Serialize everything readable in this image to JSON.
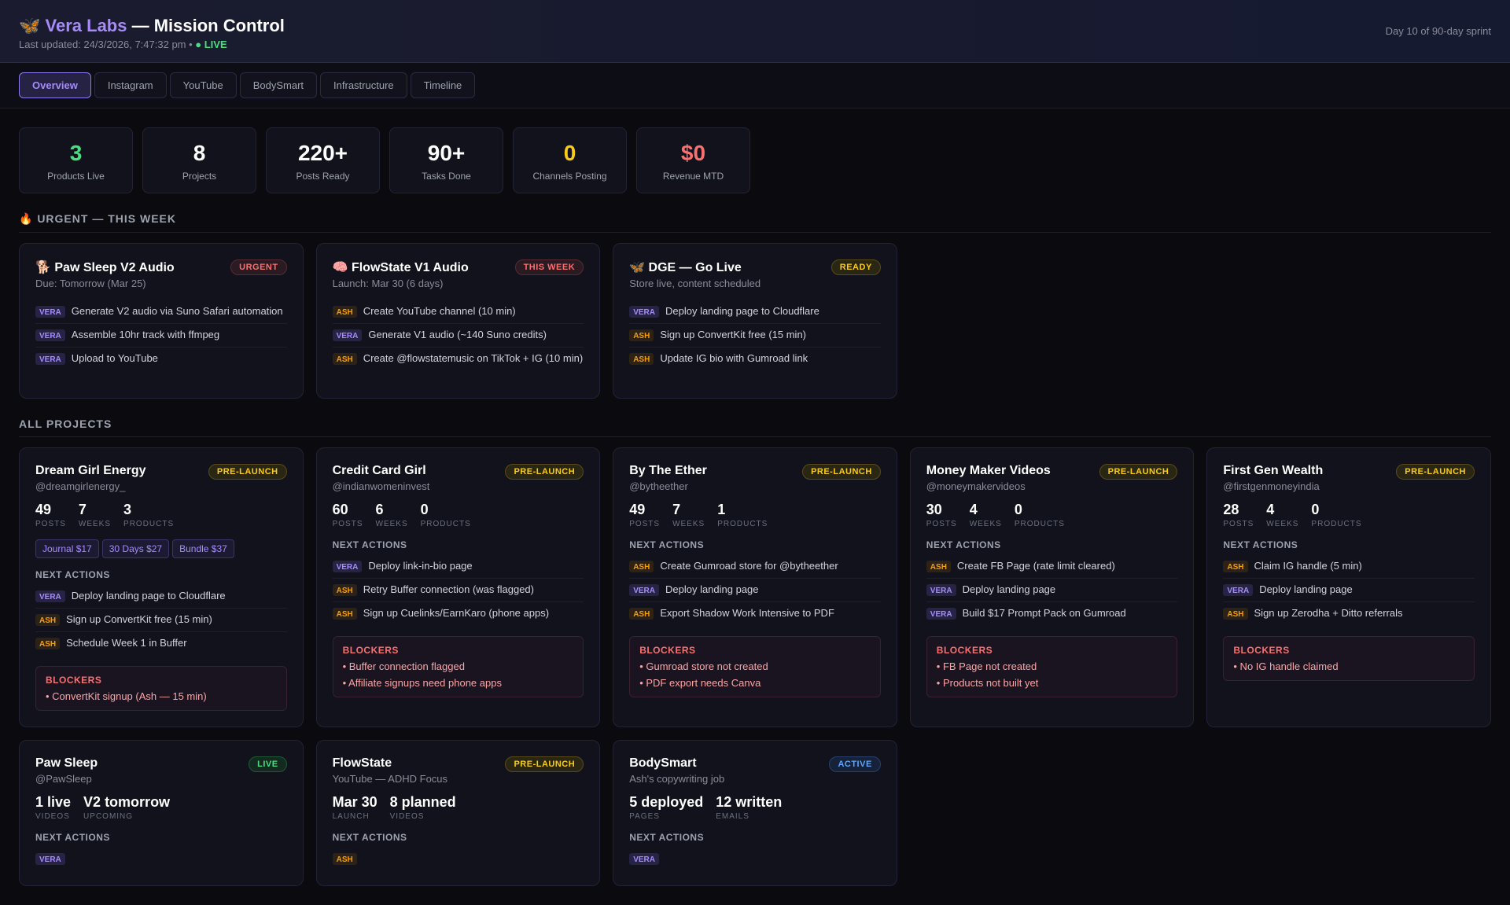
{
  "header": {
    "icon": "🦋",
    "brand": "Vera Labs",
    "title_rest": " — Mission Control",
    "updated": "Last updated: 24/3/2026, 7:47:32 pm • ",
    "live": "● LIVE",
    "sprint": "Day 10 of 90-day sprint"
  },
  "tabs": [
    "Overview",
    "Instagram",
    "YouTube",
    "BodySmart",
    "Infrastructure",
    "Timeline"
  ],
  "stats": [
    {
      "value": "3",
      "label": "Products Live",
      "color": "#4ade80"
    },
    {
      "value": "8",
      "label": "Projects",
      "color": "#ffffff"
    },
    {
      "value": "220+",
      "label": "Posts Ready",
      "color": "#ffffff"
    },
    {
      "value": "90+",
      "label": "Tasks Done",
      "color": "#ffffff"
    },
    {
      "value": "0",
      "label": "Channels Posting",
      "color": "#facc15"
    },
    {
      "value": "$0",
      "label": "Revenue MTD",
      "color": "#f87171"
    }
  ],
  "urgent_heading": "🔥 URGENT — THIS WEEK",
  "urgent": [
    {
      "title": "🐕 Paw Sleep V2 Audio",
      "sub": "Due: Tomorrow (Mar 25)",
      "badge": "URGENT",
      "badge_class": "b-urgent",
      "tasks": [
        {
          "who": "VERA",
          "text": "Generate V2 audio via Suno Safari automation"
        },
        {
          "who": "VERA",
          "text": "Assemble 10hr track with ffmpeg"
        },
        {
          "who": "VERA",
          "text": "Upload to YouTube"
        }
      ]
    },
    {
      "title": "🧠 FlowState V1 Audio",
      "sub": "Launch: Mar 30 (6 days)",
      "badge": "THIS WEEK",
      "badge_class": "b-urgent",
      "tasks": [
        {
          "who": "ASH",
          "text": "Create YouTube channel (10 min)"
        },
        {
          "who": "VERA",
          "text": "Generate V1 audio (~140 Suno credits)"
        },
        {
          "who": "ASH",
          "text": "Create @flowstatemusic on TikTok + IG (10 min)"
        }
      ]
    },
    {
      "title": "🦋 DGE — Go Live",
      "sub": "Store live, content scheduled",
      "badge": "READY",
      "badge_class": "b-ready",
      "tasks": [
        {
          "who": "VERA",
          "text": "Deploy landing page to Cloudflare"
        },
        {
          "who": "ASH",
          "text": "Sign up ConvertKit free (15 min)"
        },
        {
          "who": "ASH",
          "text": "Update IG bio with Gumroad link"
        }
      ]
    }
  ],
  "projects_heading": "ALL PROJECTS",
  "next_actions_label": "NEXT ACTIONS",
  "blockers_label": "BLOCKERS",
  "projects": [
    {
      "name": "Dream Girl Energy",
      "handle": "@dreamgirlenergy_",
      "badge": "PRE-LAUNCH",
      "badge_class": "b-pre",
      "nums": [
        {
          "v": "49",
          "l": "POSTS"
        },
        {
          "v": "7",
          "l": "WEEKS"
        },
        {
          "v": "3",
          "l": "PRODUCTS"
        }
      ],
      "products": [
        "Journal $17",
        "30 Days $27",
        "Bundle $37"
      ],
      "tasks": [
        {
          "who": "VERA",
          "text": "Deploy landing page to Cloudflare"
        },
        {
          "who": "ASH",
          "text": "Sign up ConvertKit free (15 min)"
        },
        {
          "who": "ASH",
          "text": "Schedule Week 1 in Buffer"
        }
      ],
      "blockers": [
        "• ConvertKit signup (Ash — 15 min)"
      ]
    },
    {
      "name": "Credit Card Girl",
      "handle": "@indianwomeninvest",
      "badge": "PRE-LAUNCH",
      "badge_class": "b-pre",
      "nums": [
        {
          "v": "60",
          "l": "POSTS"
        },
        {
          "v": "6",
          "l": "WEEKS"
        },
        {
          "v": "0",
          "l": "PRODUCTS"
        }
      ],
      "products": [],
      "tasks": [
        {
          "who": "VERA",
          "text": "Deploy link-in-bio page"
        },
        {
          "who": "ASH",
          "text": "Retry Buffer connection (was flagged)"
        },
        {
          "who": "ASH",
          "text": "Sign up Cuelinks/EarnKaro (phone apps)"
        }
      ],
      "blockers": [
        "• Buffer connection flagged",
        "• Affiliate signups need phone apps"
      ]
    },
    {
      "name": "By The Ether",
      "handle": "@bytheether",
      "badge": "PRE-LAUNCH",
      "badge_class": "b-pre",
      "nums": [
        {
          "v": "49",
          "l": "POSTS"
        },
        {
          "v": "7",
          "l": "WEEKS"
        },
        {
          "v": "1",
          "l": "PRODUCTS"
        }
      ],
      "products": [],
      "tasks": [
        {
          "who": "ASH",
          "text": "Create Gumroad store for @bytheether"
        },
        {
          "who": "VERA",
          "text": "Deploy landing page"
        },
        {
          "who": "ASH",
          "text": "Export Shadow Work Intensive to PDF"
        }
      ],
      "blockers": [
        "• Gumroad store not created",
        "• PDF export needs Canva"
      ]
    },
    {
      "name": "Money Maker Videos",
      "handle": "@moneymakervideos",
      "badge": "PRE-LAUNCH",
      "badge_class": "b-pre",
      "nums": [
        {
          "v": "30",
          "l": "POSTS"
        },
        {
          "v": "4",
          "l": "WEEKS"
        },
        {
          "v": "0",
          "l": "PRODUCTS"
        }
      ],
      "products": [],
      "tasks": [
        {
          "who": "ASH",
          "text": "Create FB Page (rate limit cleared)"
        },
        {
          "who": "VERA",
          "text": "Deploy landing page"
        },
        {
          "who": "VERA",
          "text": "Build $17 Prompt Pack on Gumroad"
        }
      ],
      "blockers": [
        "• FB Page not created",
        "• Products not built yet"
      ]
    },
    {
      "name": "First Gen Wealth",
      "handle": "@firstgenmoneyindia",
      "badge": "PRE-LAUNCH",
      "badge_class": "b-pre",
      "nums": [
        {
          "v": "28",
          "l": "POSTS"
        },
        {
          "v": "4",
          "l": "WEEKS"
        },
        {
          "v": "0",
          "l": "PRODUCTS"
        }
      ],
      "products": [],
      "tasks": [
        {
          "who": "ASH",
          "text": "Claim IG handle (5 min)"
        },
        {
          "who": "VERA",
          "text": "Deploy landing page"
        },
        {
          "who": "ASH",
          "text": "Sign up Zerodha + Ditto referrals"
        }
      ],
      "blockers": [
        "• No IG handle claimed"
      ]
    },
    {
      "name": "Paw Sleep",
      "handle": "@PawSleep",
      "badge": "LIVE",
      "badge_class": "b-live",
      "nums": [
        {
          "v": "1 live",
          "l": "VIDEOS"
        },
        {
          "v": "V2 tomorrow",
          "l": "UPCOMING"
        }
      ],
      "products": [],
      "tasks": [
        {
          "who": "VERA",
          "text": ""
        }
      ],
      "blockers": []
    },
    {
      "name": "FlowState",
      "handle": "YouTube — ADHD Focus",
      "badge": "PRE-LAUNCH",
      "badge_class": "b-pre",
      "nums": [
        {
          "v": "Mar 30",
          "l": "LAUNCH"
        },
        {
          "v": "8 planned",
          "l": "VIDEOS"
        }
      ],
      "products": [],
      "tasks": [
        {
          "who": "ASH",
          "text": ""
        }
      ],
      "blockers": []
    },
    {
      "name": "BodySmart",
      "handle": "Ash's copywriting job",
      "badge": "ACTIVE",
      "badge_class": "b-active",
      "nums": [
        {
          "v": "5 deployed",
          "l": "PAGES"
        },
        {
          "v": "12 written",
          "l": "EMAILS"
        }
      ],
      "products": [],
      "tasks": [
        {
          "who": "VERA",
          "text": ""
        }
      ],
      "blockers": []
    }
  ]
}
